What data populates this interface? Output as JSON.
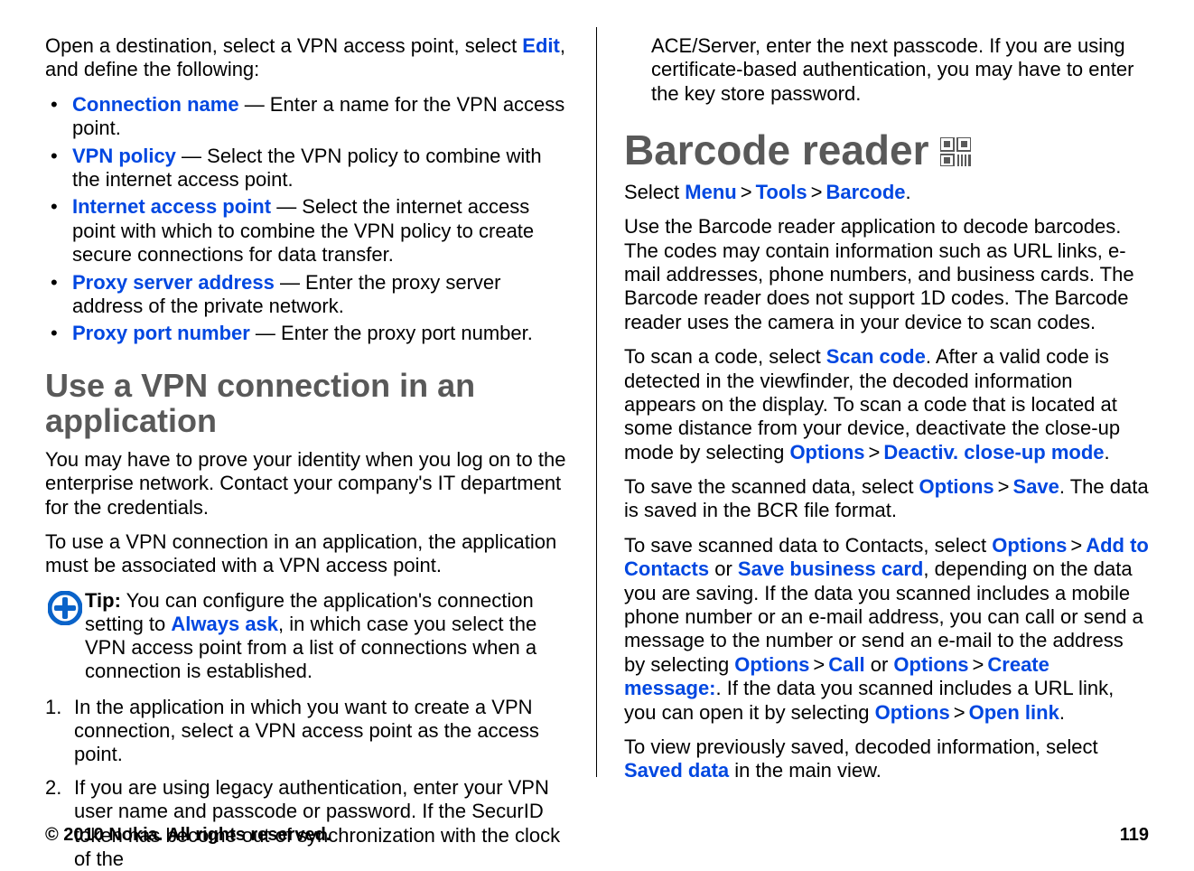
{
  "left": {
    "intro_a": "Open a destination, select a VPN access point, select ",
    "intro_edit": "Edit",
    "intro_b": ", and define the following:",
    "bullets": [
      {
        "term": "Connection name",
        "text": " — Enter a name for the VPN access point."
      },
      {
        "term": "VPN policy",
        "text": " — Select the VPN policy to combine with the internet access point."
      },
      {
        "term": "Internet access point",
        "text": " — Select the internet access point with which to combine the VPN policy to create secure connections for data transfer."
      },
      {
        "term": "Proxy server address",
        "text": " — Enter the proxy server address of the private network."
      },
      {
        "term": "Proxy port number",
        "text": " — Enter the proxy port number."
      }
    ],
    "h2": "Use a VPN connection in an application",
    "p1": "You may have to prove your identity when you log on to the enterprise network. Contact your company's IT department for the credentials.",
    "p2": "To use a VPN connection in an application, the application must be associated with a VPN access point.",
    "tip_label": "Tip:",
    "tip_a": " You can configure the application's connection setting to ",
    "tip_term": "Always ask",
    "tip_b": ", in which case you select the VPN access point from a list of connections when a connection is established.",
    "ol": [
      {
        "num": "1.",
        "text": "In the application in which you want to create a VPN connection, select a VPN access point as the access point."
      },
      {
        "num": "2.",
        "text": "If you are using legacy authentication, enter your VPN user name and passcode or password. If the SecurID token has become out of synchronization with the clock of the"
      }
    ]
  },
  "right": {
    "continuation": "ACE/Server, enter the next passcode. If you are using certificate-based authentication, you may have to enter the key store password.",
    "h1": "Barcode reader",
    "nav_select": "Select ",
    "nav_menu": "Menu",
    "nav_tools": "Tools",
    "nav_barcode": "Barcode",
    "p1": "Use the Barcode reader application to decode barcodes. The codes may contain information such as URL links, e-mail addresses, phone numbers, and business cards. The Barcode reader does not support 1D codes. The Barcode reader uses the camera in your device to scan codes.",
    "p2_a": "To scan a code, select ",
    "p2_scan": "Scan code",
    "p2_b": ". After a valid code is detected in the viewfinder, the decoded information appears on the display. To scan a code that is located at some distance from your device, deactivate the close-up mode by selecting ",
    "p2_options": "Options",
    "p2_deact": "Deactiv. close-up mode",
    "p3_a": "To save the scanned data, select ",
    "p3_options": "Options",
    "p3_save": "Save",
    "p3_b": ". The data is saved in the BCR file format.",
    "p4_a": "To save scanned data to Contacts, select ",
    "p4_options1": "Options",
    "p4_add": "Add to Contacts",
    "p4_or1": " or ",
    "p4_savecard": "Save business card",
    "p4_b": ", depending on the data you are saving. If the data you scanned includes a mobile phone number or an e-mail address, you can call or send a message to the number or send an e-mail to the address by selecting ",
    "p4_options2": "Options",
    "p4_call": "Call",
    "p4_or2": " or ",
    "p4_options3": "Options",
    "p4_create": "Create message:",
    "p4_c": ". If the data you scanned includes a URL link, you can open it by selecting ",
    "p4_options4": "Options",
    "p4_open": "Open link",
    "p5_a": "To view previously saved, decoded information, select ",
    "p5_saved": "Saved data",
    "p5_b": " in the main view.",
    "gt": ">",
    "period": "."
  },
  "footer": {
    "copyright": "© 2010 Nokia. All rights reserved.",
    "page": "119"
  }
}
